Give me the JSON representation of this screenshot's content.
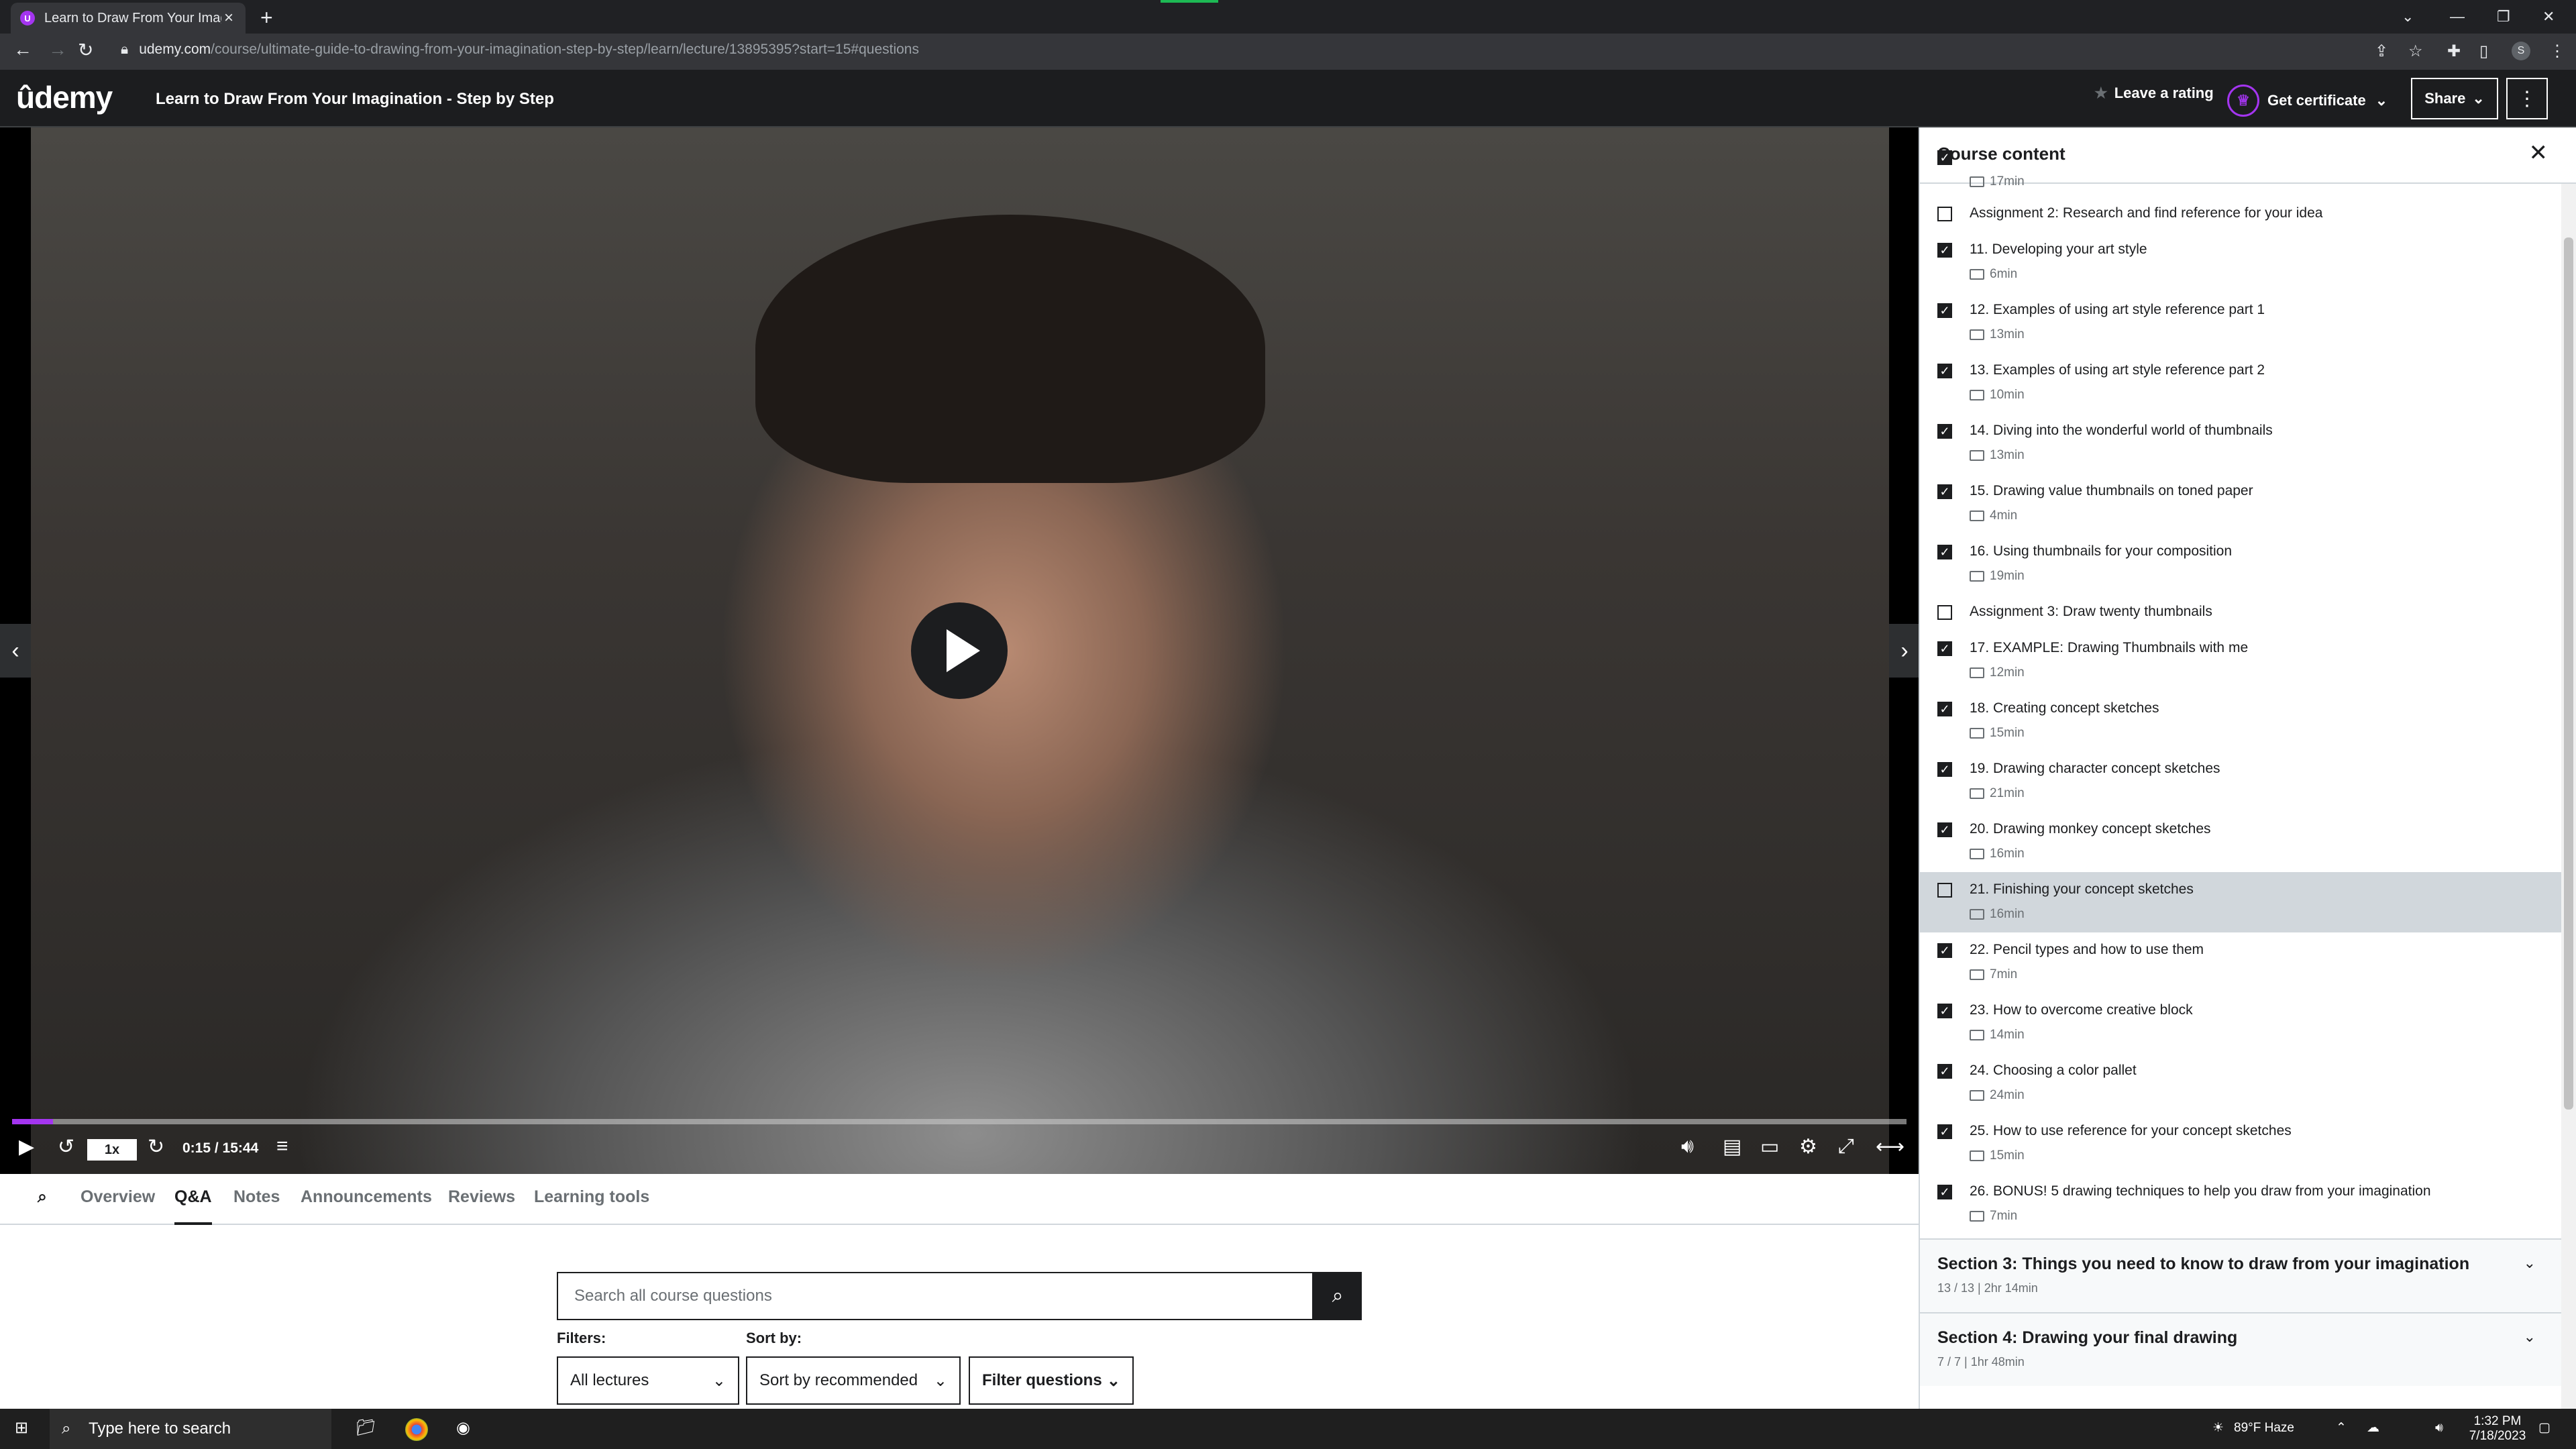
{
  "browser": {
    "tab_title": "Learn to Draw From Your Imagina",
    "url_host": "udemy.com",
    "url_path": "/course/ultimate-guide-to-drawing-from-your-imagination-step-by-step/learn/lecture/13895395?start=15#questions",
    "profile_initial": "S"
  },
  "header": {
    "logo": "ûdemy",
    "course_title": "Learn to Draw From Your Imagination - Step by Step",
    "rating_label": "Leave a rating",
    "certificate_label": "Get certificate",
    "share_label": "Share"
  },
  "player": {
    "speed": "1x",
    "time": "0:15 / 15:44",
    "progress_fraction": 0.0016
  },
  "subnav": {
    "tabs": [
      "Overview",
      "Q&A",
      "Notes",
      "Announcements",
      "Reviews",
      "Learning tools"
    ],
    "active": "Q&A"
  },
  "qa": {
    "search_placeholder": "Search all course questions",
    "filters_label": "Filters:",
    "sort_label": "Sort by:",
    "lectures_value": "All lectures",
    "sort_value": "Sort by recommended",
    "filter_questions": "Filter questions"
  },
  "sidebar": {
    "title": "Course content",
    "items": [
      {
        "title": "",
        "dur": "17min",
        "checked": true,
        "type": "partial"
      },
      {
        "title": "Assignment 2: Research and find reference for your idea",
        "dur": "",
        "checked": false,
        "type": "assign"
      },
      {
        "title": "11. Developing your art style",
        "dur": "6min",
        "checked": true
      },
      {
        "title": "12. Examples of using art style reference part 1",
        "dur": "13min",
        "checked": true
      },
      {
        "title": "13. Examples of using art style reference part 2",
        "dur": "10min",
        "checked": true
      },
      {
        "title": "14. Diving into the wonderful world of thumbnails",
        "dur": "13min",
        "checked": true
      },
      {
        "title": "15. Drawing value thumbnails on toned paper",
        "dur": "4min",
        "checked": true
      },
      {
        "title": "16. Using thumbnails for your composition",
        "dur": "19min",
        "checked": true
      },
      {
        "title": "Assignment 3: Draw twenty thumbnails",
        "dur": "",
        "checked": false,
        "type": "assign"
      },
      {
        "title": "17. EXAMPLE: Drawing Thumbnails with me",
        "dur": "12min",
        "checked": true
      },
      {
        "title": "18. Creating concept sketches",
        "dur": "15min",
        "checked": true
      },
      {
        "title": "19. Drawing character concept sketches",
        "dur": "21min",
        "checked": true
      },
      {
        "title": "20. Drawing monkey concept sketches",
        "dur": "16min",
        "checked": true
      },
      {
        "title": "21. Finishing your concept sketches",
        "dur": "16min",
        "checked": false,
        "highlight": true
      },
      {
        "title": "22. Pencil types and how to use them",
        "dur": "7min",
        "checked": true
      },
      {
        "title": "23. How to overcome creative block",
        "dur": "14min",
        "checked": true
      },
      {
        "title": "24. Choosing a color pallet",
        "dur": "24min",
        "checked": true
      },
      {
        "title": "25. How to use reference for your concept sketches",
        "dur": "15min",
        "checked": true
      },
      {
        "title": "26. BONUS! 5 drawing techniques to help you draw from your imagination",
        "dur": "7min",
        "checked": true
      }
    ],
    "sections": [
      {
        "title": "Section 3: Things you need to know to draw from your imagination",
        "meta": "13 / 13 | 2hr 14min"
      },
      {
        "title": "Section 4: Drawing your final drawing",
        "meta": "7 / 7 | 1hr 48min"
      }
    ]
  },
  "taskbar": {
    "search_placeholder": "Type here to search",
    "weather": "89°F  Haze",
    "time": "1:32 PM",
    "date": "7/18/2023"
  }
}
